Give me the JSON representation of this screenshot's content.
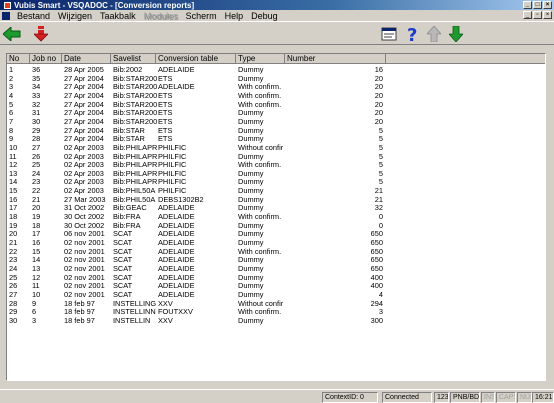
{
  "window": {
    "title": "Vubis Smart - VSQADOC - [Conversion reports]",
    "minimize": "_",
    "maximize": "□",
    "close": "×"
  },
  "menu": [
    "Bestand",
    "Wijzigen",
    "Taakbalk",
    "Modules",
    "Scherm",
    "Help",
    "Debug"
  ],
  "mdi": {
    "minimize": "_",
    "restore": "▫",
    "close": "×"
  },
  "columns": [
    "No",
    "Job no",
    "Date",
    "Savelist",
    "Conversion table",
    "Type",
    "Number"
  ],
  "rows": [
    [
      "1",
      "36",
      "28 Apr 2005",
      "Bib:2002",
      "ADELAIDE",
      "Dummy",
      "16"
    ],
    [
      "2",
      "35",
      "27 Apr 2004",
      "Bib:STAR200",
      "ETS",
      "Dummy",
      "20"
    ],
    [
      "3",
      "34",
      "27 Apr 2004",
      "Bib:STAR200",
      "ADELAIDE",
      "With confirm.",
      "20"
    ],
    [
      "4",
      "33",
      "27 Apr 2004",
      "Bib:STAR200",
      "ETS",
      "With confirm.",
      "20"
    ],
    [
      "5",
      "32",
      "27 Apr 2004",
      "Bib:STAR200",
      "ETS",
      "With confirm.",
      "20"
    ],
    [
      "6",
      "31",
      "27 Apr 2004",
      "Bib:STAR200",
      "ETS",
      "Dummy",
      "20"
    ],
    [
      "7",
      "30",
      "27 Apr 2004",
      "Bib:STAR200",
      "ETS",
      "Dummy",
      "20"
    ],
    [
      "8",
      "29",
      "27 Apr 2004",
      "Bib:STAR",
      "ETS",
      "Dummy",
      "5"
    ],
    [
      "9",
      "28",
      "27 Apr 2004",
      "Bib:STAR",
      "ETS",
      "Dummy",
      "5"
    ],
    [
      "10",
      "27",
      "02 Apr 2003",
      "Bib:PHILAPR",
      "PHILFIC",
      "Without confir",
      "5"
    ],
    [
      "11",
      "26",
      "02 Apr 2003",
      "Bib:PHILAPR",
      "PHILFIC",
      "Dummy",
      "5"
    ],
    [
      "12",
      "25",
      "02 Apr 2003",
      "Bib:PHILAPR",
      "PHILFIC",
      "With confirm.",
      "5"
    ],
    [
      "13",
      "24",
      "02 Apr 2003",
      "Bib:PHILAPR",
      "PHILFIC",
      "Dummy",
      "5"
    ],
    [
      "14",
      "23",
      "02 Apr 2003",
      "Bib:PHILAPR",
      "PHILFIC",
      "Dummy",
      "5"
    ],
    [
      "15",
      "22",
      "02 Apr 2003",
      "Bib:PHIL50A",
      "PHILFIC",
      "Dummy",
      "21"
    ],
    [
      "16",
      "21",
      "27 Mar 2003",
      "Bib:PHIL50A",
      "DEBS1302B2",
      "Dummy",
      "21"
    ],
    [
      "17",
      "20",
      "31 Oct 2002",
      "Bib:GEAC",
      "ADELAIDE",
      "Dummy",
      "32"
    ],
    [
      "18",
      "19",
      "30 Oct 2002",
      "Bib:FRA",
      "ADELAIDE",
      "With confirm.",
      "0"
    ],
    [
      "19",
      "18",
      "30 Oct 2002",
      "Bib:FRA",
      "ADELAIDE",
      "Dummy",
      "0"
    ],
    [
      "20",
      "17",
      "06 nov 2001",
      "SCAT",
      "ADELAIDE",
      "Dummy",
      "650"
    ],
    [
      "21",
      "16",
      "02 nov 2001",
      "SCAT",
      "ADELAIDE",
      "Dummy",
      "650"
    ],
    [
      "22",
      "15",
      "02 nov 2001",
      "SCAT",
      "ADELAIDE",
      "With confirm.",
      "650"
    ],
    [
      "23",
      "14",
      "02 nov 2001",
      "SCAT",
      "ADELAIDE",
      "Dummy",
      "650"
    ],
    [
      "24",
      "13",
      "02 nov 2001",
      "SCAT",
      "ADELAIDE",
      "Dummy",
      "650"
    ],
    [
      "25",
      "12",
      "02 nov 2001",
      "SCAT",
      "ADELAIDE",
      "Dummy",
      "400"
    ],
    [
      "26",
      "11",
      "02 nov 2001",
      "SCAT",
      "ADELAIDE",
      "Dummy",
      "400"
    ],
    [
      "27",
      "10",
      "02 nov 2001",
      "SCAT",
      "ADELAIDE",
      "Dummy",
      "4"
    ],
    [
      "28",
      "9",
      "18 feb 97",
      "INSTELLING",
      "XXV",
      "Without confir",
      "294"
    ],
    [
      "29",
      "6",
      "18 feb 97",
      "INSTELLINN",
      "FOUTXXV",
      "With confirm.",
      "3"
    ],
    [
      "30",
      "3",
      "18 feb 97",
      "INSTELLIN",
      "XXV",
      "Dummy",
      "300"
    ]
  ],
  "status": {
    "context": "ContextID: 0",
    "connection": "Connected",
    "count": "123",
    "db": "PNB/BD",
    "ins": "INS",
    "caps": "CAPS",
    "num": "NUM",
    "time": "16:21"
  },
  "icons": {
    "back": "arrow-left-icon",
    "down_red": "arrow-down-red-icon",
    "form": "form-icon",
    "help": "help-icon",
    "up": "arrow-up-icon",
    "down": "arrow-down-icon"
  },
  "colors": {
    "title_start": "#0a246a",
    "green_arrow": "#1e9b2e",
    "red_arrow": "#d42020",
    "help_blue": "#1a3cc8"
  }
}
